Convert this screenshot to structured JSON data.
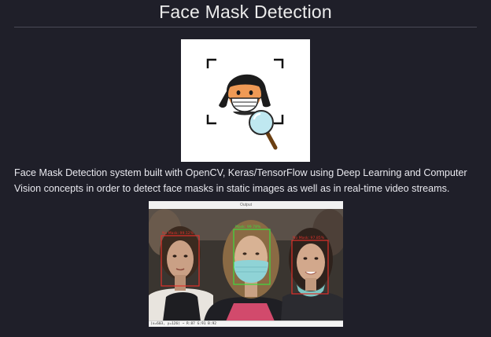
{
  "page": {
    "title": "Face Mask Detection",
    "description": "Face Mask Detection system built with OpenCV, Keras/TensorFlow using Deep Learning and Computer Vision concepts in order to detect face masks in static images as well as in real-time video streams."
  },
  "logo": {
    "icon": "masked-face-magnifier-icon"
  },
  "demo_window": {
    "window_title": "Output",
    "status_text": "(x=603, y=126) ~ R:87 G:91 B:92",
    "detections": [
      {
        "label": "No Mask: 99.12%",
        "color": "#e0302a"
      },
      {
        "label": "Mask: 99.78%",
        "color": "#3fdc3f"
      },
      {
        "label": "No Mask: 97.85%",
        "color": "#e0302a"
      }
    ]
  },
  "colors": {
    "background": "#1f1f29",
    "mask_box": "#3fdc3f",
    "no_mask_box": "#e0302a"
  }
}
